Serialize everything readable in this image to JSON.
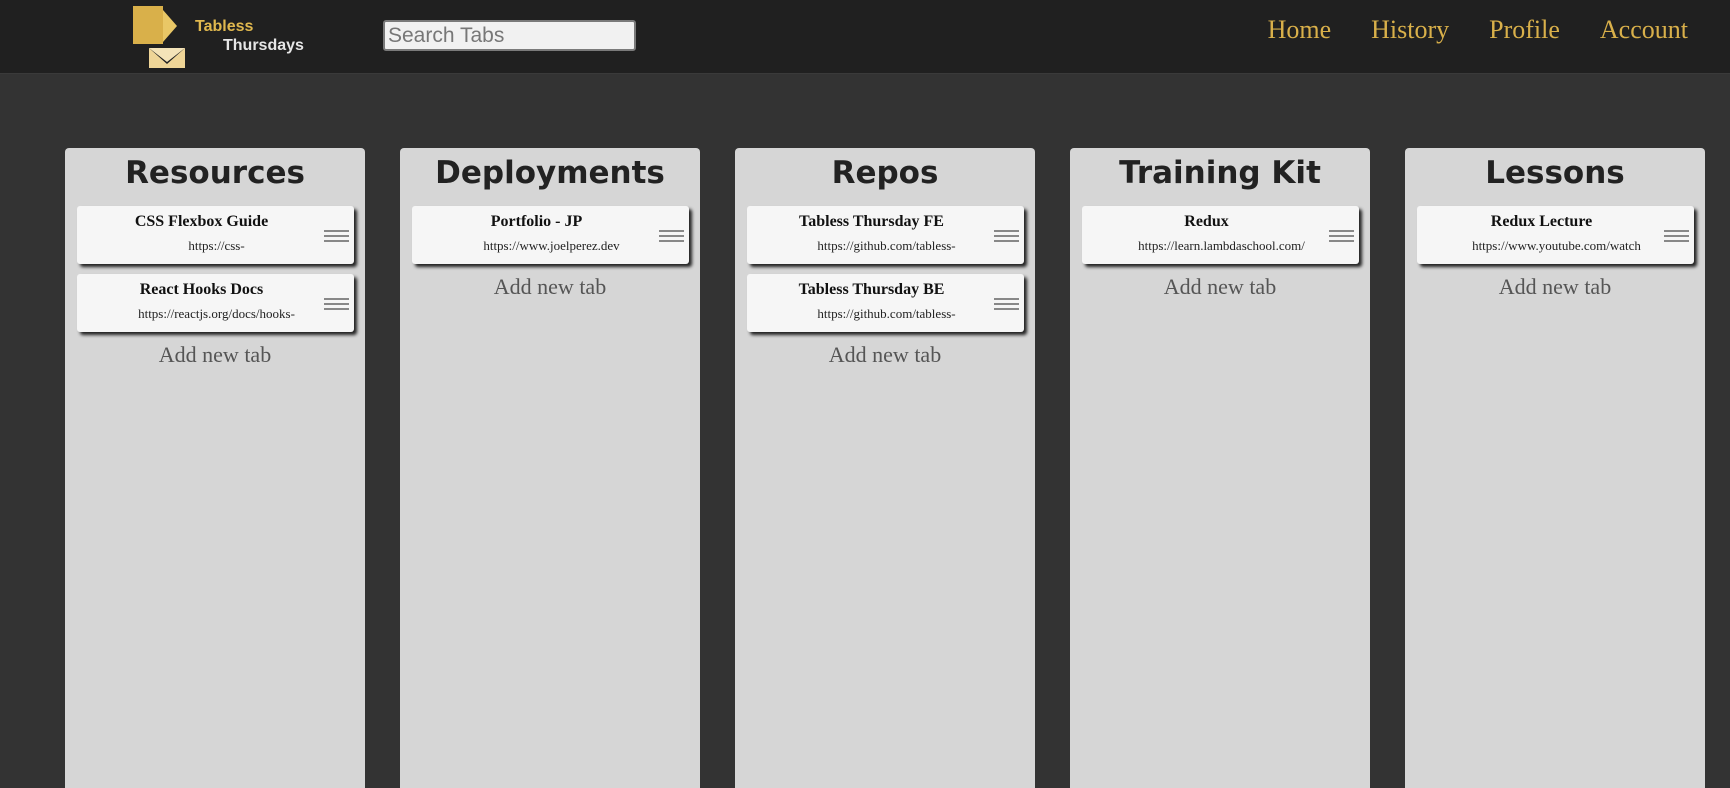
{
  "brand": {
    "line1": "Tabless",
    "line2": "Thursdays"
  },
  "search": {
    "placeholder": "Search Tabs",
    "value": ""
  },
  "nav": [
    "Home",
    "History",
    "Profile",
    "Account"
  ],
  "colors": {
    "topbar": "#202020",
    "page": "#333333",
    "column": "#d6d6d6",
    "accent": "#d9b04a"
  },
  "columns": [
    {
      "title": "Resources",
      "add_label": "Add new tab",
      "cards": [
        {
          "title": "CSS Flexbox Guide",
          "url": "https://css-"
        },
        {
          "title": "React Hooks Docs",
          "url": "https://reactjs.org/docs/hooks-"
        }
      ]
    },
    {
      "title": "Deployments",
      "add_label": "Add new tab",
      "cards": [
        {
          "title": "Portfolio - JP",
          "url": "https://www.joelperez.dev"
        }
      ]
    },
    {
      "title": "Repos",
      "add_label": "Add new tab",
      "cards": [
        {
          "title": "Tabless Thursday FE",
          "url": "https://github.com/tabless-"
        },
        {
          "title": "Tabless Thursday BE",
          "url": "https://github.com/tabless-"
        }
      ]
    },
    {
      "title": "Training Kit",
      "add_label": "Add new tab",
      "cards": [
        {
          "title": "Redux",
          "url": "https://learn.lambdaschool.com/"
        }
      ]
    },
    {
      "title": "Lessons",
      "add_label": "Add new tab",
      "cards": [
        {
          "title": "Redux Lecture",
          "url": "https://www.youtube.com/watch"
        }
      ]
    }
  ]
}
